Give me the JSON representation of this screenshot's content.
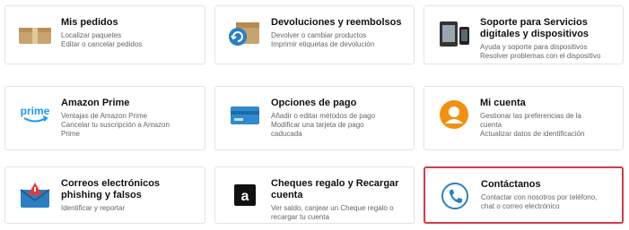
{
  "cards": [
    {
      "title": "Mis pedidos",
      "lines": [
        "Localizar paquetes",
        "Editar o cancelar pedidos"
      ]
    },
    {
      "title": "Devoluciones y reembolsos",
      "lines": [
        "Devolver o cambiar productos",
        "Imprimir etiquetas de devolución"
      ]
    },
    {
      "title": "Soporte para Servicios digitales y dispositivos",
      "lines": [
        "Ayuda y soporte para dispositivos",
        "Resolver problemas con el dispositivo"
      ]
    },
    {
      "title": "Amazon Prime",
      "lines": [
        "Ventajas de Amazon Prime",
        "Cancelar tu suscripción a Amazon",
        "Prime"
      ]
    },
    {
      "title": "Opciones de pago",
      "lines": [
        "Añadir o editar métodos de pago",
        "Modificar una tarjeta de pago",
        "caducada"
      ]
    },
    {
      "title": "Mi cuenta",
      "lines": [
        "Gestionar las preferencias de la",
        "cuenta",
        "Actualizar datos de identificación"
      ]
    },
    {
      "title": "Correos electrónicos phishing y falsos",
      "lines": [
        "Identificar y reportar"
      ]
    },
    {
      "title": "Cheques regalo y Recargar cuenta",
      "lines": [
        "Ver saldo, canjear un Cheque regalo o",
        "recargar tu cuenta"
      ]
    },
    {
      "title": "Contáctanos",
      "lines": [
        "Contactar con nosotros por teléfono,",
        "chat o correo electrónico"
      ]
    }
  ],
  "icons": {
    "prime_text": "prime",
    "amazon_letter": "a"
  },
  "colors": {
    "highlight_border": "#d23b48",
    "prime_blue": "#1a98ff",
    "orange": "#f29111"
  }
}
